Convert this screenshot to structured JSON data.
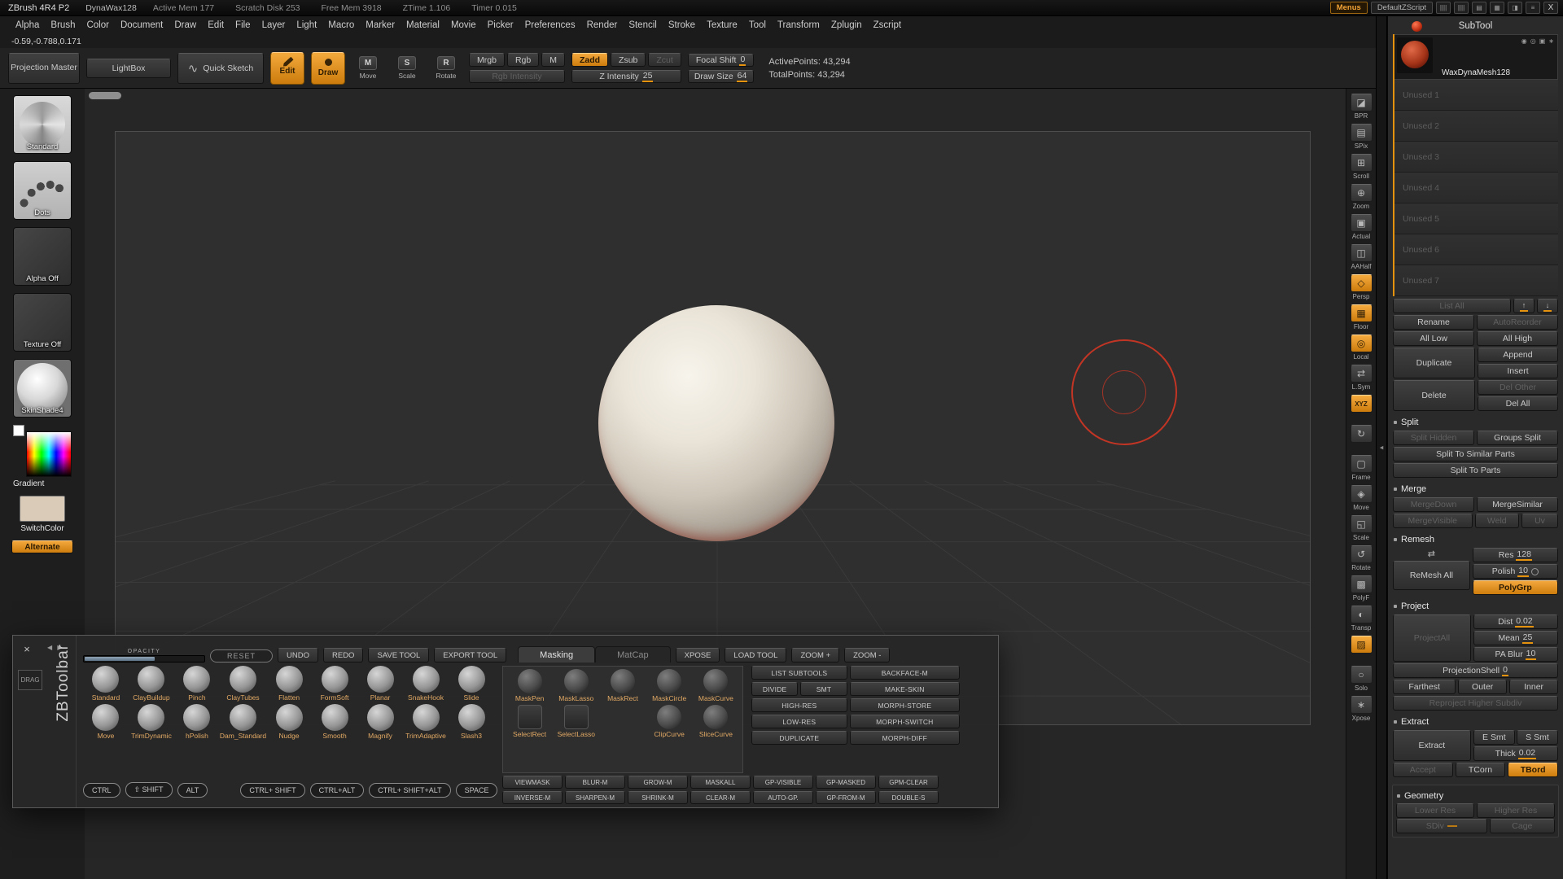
{
  "colors": {
    "accent": "#e5920f",
    "cursor_red": "#c23524",
    "canvas_bg": "#2f2f2f"
  },
  "icons": {
    "titlebar": [
      {
        "name": "customize-sliders-icon",
        "glyph": "||||"
      },
      {
        "name": "divider-bars-icon",
        "glyph": "||||"
      },
      {
        "name": "swatch-panel-icon",
        "glyph": "▤"
      },
      {
        "name": "grid-panel-icon",
        "glyph": "▦"
      },
      {
        "name": "half-tone-icon",
        "glyph": "◨"
      },
      {
        "name": "menu-lines-icon",
        "glyph": "≡"
      }
    ],
    "divider_handle": "◂",
    "rail_arrows": "◀ ▶",
    "quick_sketch": "∿",
    "msr_move": "M",
    "msr_scale": "S",
    "msr_rotate": "R",
    "remesh_sym": "⇄",
    "eye_icon": "◉",
    "eye2_icon": "◎",
    "paint_icon": "▣",
    "sculpt_icon": "∗",
    "up_arrow": "↑",
    "down_arrow": "↓"
  },
  "title_bar": {
    "app_title": "ZBrush 4R4 P2",
    "doc_title": "DynaWax128",
    "stats": [
      "Active Mem 177",
      "Scratch Disk 253",
      "Free Mem 3918",
      "ZTime 1.106",
      "Timer 0.015"
    ],
    "menus_button": "Menus",
    "zscript_button": "DefaultZScript",
    "close_button": "X"
  },
  "menu_bar": {
    "items": [
      "Alpha",
      "Brush",
      "Color",
      "Document",
      "Draw",
      "Edit",
      "File",
      "Layer",
      "Light",
      "Macro",
      "Marker",
      "Material",
      "Movie",
      "Picker",
      "Preferences",
      "Render",
      "Stencil",
      "Stroke",
      "Texture",
      "Tool",
      "Transform",
      "Zplugin",
      "Zscript"
    ]
  },
  "status": {
    "coords": "-0.59,-0.788,0.171"
  },
  "top_shelf": {
    "projection_master": "Projection Master",
    "lightbox": "LightBox",
    "quick_sketch": "Quick Sketch",
    "edit": "Edit",
    "draw": "Draw",
    "move": "Move",
    "scale": "Scale",
    "rotate": "Rotate",
    "mrgb": "Mrgb",
    "rgb": "Rgb",
    "m": "M",
    "zadd": "Zadd",
    "zsub": "Zsub",
    "zcut": "Zcut",
    "rgb_intensity": {
      "label": "Rgb Intensity",
      "value": ""
    },
    "z_intensity": {
      "label": "Z Intensity",
      "value": "25"
    },
    "focal_shift": {
      "label": "Focal Shift",
      "value": "0"
    },
    "draw_size": {
      "label": "Draw Size",
      "value": "64"
    },
    "active_points": "ActivePoints: 43,294",
    "total_points": "TotalPoints: 43,294"
  },
  "left_tray": {
    "brush_label": "Standard",
    "stroke_label": "Dots",
    "alpha_label": "Alpha Off",
    "texture_label": "Texture Off",
    "material_label": "SkinShade4",
    "gradient_label": "Gradient",
    "switch_color_label": "SwitchColor",
    "alternate_label": "Alternate"
  },
  "right_shelf": {
    "items": [
      {
        "label": "BPR",
        "icon": "◪"
      },
      {
        "label": "SPix",
        "icon": "▤"
      },
      {
        "label": "Scroll",
        "icon": "⊞"
      },
      {
        "label": "Zoom",
        "icon": "⊕"
      },
      {
        "label": "Actual",
        "icon": "▣"
      },
      {
        "label": "AAHalf",
        "icon": "◫"
      },
      {
        "label": "Persp",
        "icon": "◇",
        "state": "on"
      },
      {
        "label": "Floor",
        "icon": "▦",
        "state": "on"
      },
      {
        "label": "Local",
        "icon": "◎",
        "state": "on"
      },
      {
        "label": "L.Sym",
        "icon": "⇄"
      },
      {
        "label": "",
        "icon": "XYZ",
        "state": "on",
        "kind": "text"
      },
      {
        "label": "",
        "icon": "↻"
      },
      {
        "label": "Frame",
        "icon": "▢"
      },
      {
        "label": "Move",
        "icon": "◈"
      },
      {
        "label": "Scale",
        "icon": "◱"
      },
      {
        "label": "Rotate",
        "icon": "↺"
      },
      {
        "label": "PolyF",
        "icon": "▩"
      },
      {
        "label": "Transp",
        "icon": "◐"
      },
      {
        "label": "",
        "icon": "▨",
        "state": "on"
      },
      {
        "label": "Solo",
        "icon": "○"
      },
      {
        "label": "Xpose",
        "icon": "∗"
      }
    ]
  },
  "subtool": {
    "header": "SubTool",
    "active_name": "WaxDynaMesh128",
    "slots": [
      "Unused 1",
      "Unused 2",
      "Unused 3",
      "Unused 4",
      "Unused 5",
      "Unused 6",
      "Unused 7"
    ],
    "list_all": "List All",
    "rename": "Rename",
    "auto_reorder": "AutoReorder",
    "all_low": "All Low",
    "all_high": "All High",
    "duplicate": "Duplicate",
    "append": "Append",
    "insert": "Insert",
    "del": "Delete",
    "del_other": "Del Other",
    "del_all": "Del All",
    "split_header": "Split",
    "split_hidden": "Split Hidden",
    "groups_split": "Groups Split",
    "split_similar": "Split To Similar Parts",
    "split_parts": "Split To Parts",
    "merge_header": "Merge",
    "merge_down": "MergeDown",
    "merge_similar": "MergeSimilar",
    "merge_visible": "MergeVisible",
    "weld": "Weld",
    "uv": "Uv",
    "remesh_header": "Remesh",
    "remesh_all": "ReMesh All",
    "res_label": "Res",
    "res_value": "128",
    "polish_label": "Polish",
    "polish_value": "10",
    "polygrp": "PolyGrp",
    "project_header": "Project",
    "project_all": "ProjectAll",
    "dist_label": "Dist",
    "dist_value": "0.02",
    "mean_label": "Mean",
    "mean_value": "25",
    "pa_blur_label": "PA Blur",
    "pa_blur_value": "10",
    "shell_label": "ProjectionShell",
    "shell_value": "0",
    "farthest": "Farthest",
    "outer": "Outer",
    "inner": "Inner",
    "reproject": "Reproject Higher Subdiv",
    "extract_header": "Extract",
    "extract": "Extract",
    "e_smt": "E Smt",
    "s_smt": "S Smt",
    "thick_label": "Thick",
    "thick_value": "0.02",
    "accept": "Accept",
    "tcorn": "TCorn",
    "tbord": "TBord",
    "geometry_header": "Geometry",
    "lower_res": "Lower Res",
    "higher_res": "Higher Res",
    "sdiv_label": "SDiv",
    "cage": "Cage"
  },
  "zbtoolbar": {
    "close": "×",
    "drag": "DRAG",
    "title": "ZBToolbar",
    "opacity_label": "OPACITY",
    "reset": "RESET",
    "undo": "UNDO",
    "redo": "REDO",
    "save_tool": "SAVE TOOL",
    "export_tool": "EXPORT TOOL",
    "tab_masking": "Masking",
    "tab_matcap": "MatCap",
    "xpose": "XPOSE",
    "load_tool": "LOAD TOOL",
    "zoom_in": "ZOOM +",
    "zoom_out": "ZOOM -",
    "brushes": [
      "Standard",
      "ClayBuildup",
      "Pinch",
      "ClayTubes",
      "Flatten",
      "FormSoft",
      "Planar",
      "SnakeHook",
      "Slide",
      "Move",
      "TrimDynamic",
      "hPolish",
      "Dam_Standard",
      "Nudge",
      "Smooth",
      "Magnify",
      "TrimAdaptive",
      "Slash3"
    ],
    "mask_tools": [
      {
        "label": "MaskPen",
        "kind": "sphere"
      },
      {
        "label": "MaskLasso",
        "kind": "sphere"
      },
      {
        "label": "MaskRect",
        "kind": "sphere"
      },
      {
        "label": "MaskCircle",
        "kind": "sphere"
      },
      {
        "label": "MaskCurve",
        "kind": "sphere"
      },
      {
        "label": "SelectRect",
        "kind": "flat"
      },
      {
        "label": "SelectLasso",
        "kind": "flat"
      },
      {
        "label": "",
        "kind": "empty"
      },
      {
        "label": "ClipCurve",
        "kind": "sphere"
      },
      {
        "label": "SliceCurve",
        "kind": "sphere"
      }
    ],
    "ops": {
      "list_subtools": "LIST SUBTOOLS",
      "backface_m": "BACKFACE-M",
      "divide": "DIVIDE",
      "smt": "SMT",
      "make_skin": "MAKE-SKIN",
      "high_res": "HIGH-RES",
      "morph_store": "MORPH-STORE",
      "low_res": "LOW-RES",
      "morph_switch": "MORPH-SWITCH",
      "duplicate": "DUPLICATE",
      "morph_diff": "MORPH-DIFF"
    },
    "mask_row1": [
      "VIEWMASK",
      "BLUR-M",
      "GROW-M",
      "MASKALL",
      "GP-VISIBLE",
      "GP-MASKED",
      "GPM-CLEAR"
    ],
    "mask_row2": [
      "INVERSE-M",
      "SHARPEN-M",
      "SHRINK-M",
      "CLEAR-M",
      "AUTO-GP.",
      "GP-FROM-M",
      "DOUBLE-S"
    ],
    "modifiers": [
      "CTRL",
      "⇧ SHIFT",
      "ALT",
      "CTRL+ SHIFT",
      "CTRL+ALT",
      "CTRL+ SHIFT+ALT",
      "SPACE"
    ]
  }
}
